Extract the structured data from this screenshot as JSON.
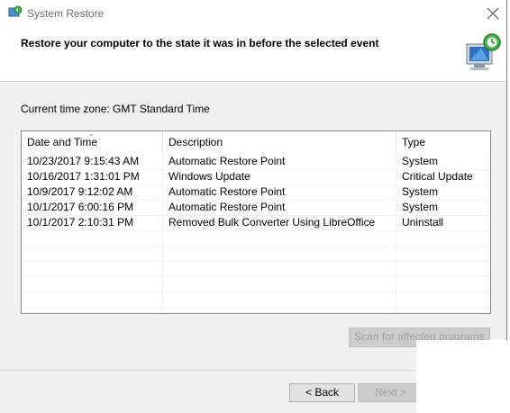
{
  "window": {
    "title": "System Restore"
  },
  "header": {
    "title": "Restore your computer to the state it was in before the selected event"
  },
  "timezone": {
    "text": "Current time zone: GMT Standard Time"
  },
  "table": {
    "columns": [
      "Date and Time",
      "Description",
      "Type"
    ],
    "rows": [
      [
        "10/23/2017 9:15:43 AM",
        "Automatic Restore Point",
        "System"
      ],
      [
        "10/16/2017 1:31:01 PM",
        "Windows Update",
        "Critical Update"
      ],
      [
        "10/9/2017 9:12:02 AM",
        "Automatic Restore Point",
        "System"
      ],
      [
        "10/1/2017 6:00:16 PM",
        "Automatic Restore Point",
        "System"
      ],
      [
        "10/1/2017 2:10:31 PM",
        "Removed Bulk Converter Using LibreOffice",
        "Uninstall"
      ]
    ]
  },
  "buttons": {
    "scan": "Scan for affected programs",
    "back": "< Back",
    "next": "Next >"
  },
  "icons": {
    "app": "system-restore-icon",
    "header": "computer-restore-icon",
    "close": "close-icon",
    "sort": "sort-down-icon"
  },
  "colors": {
    "accent": "#2f7d2f",
    "border": "#828790",
    "button": "#e1e1e1"
  }
}
